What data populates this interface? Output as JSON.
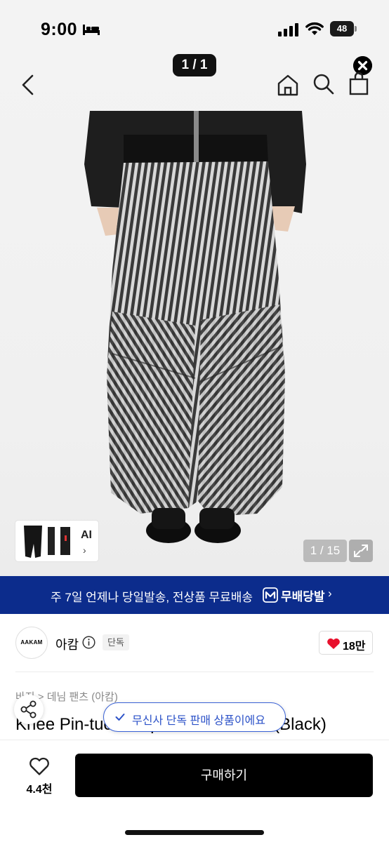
{
  "status_bar": {
    "time": "9:00",
    "battery": "48",
    "icons": [
      "bed-icon",
      "signal-icon",
      "wifi-icon",
      "battery-icon"
    ]
  },
  "top_nav": {
    "image_counter": "1 / 1",
    "icons": [
      "back-icon",
      "close-icon",
      "home-icon",
      "search-icon",
      "bag-icon"
    ]
  },
  "gallery": {
    "ai_label": "AI",
    "ai_chevron": "›",
    "page_indicator": "1 / 15",
    "expand_icon": "expand-icon"
  },
  "shipping_banner": {
    "text": "주 7일 언제나 당일발송, 전상품 무료배송",
    "brand": "무배당발",
    "chevron": "›",
    "background": "#0c2c8c"
  },
  "brand": {
    "logo_text": "AAKAM",
    "name": "아캄",
    "tag": "단독",
    "like_count": "18만",
    "heart_color": "#e8112d"
  },
  "product": {
    "breadcrumb": "바지 > 데님 팬츠 (아캄)",
    "title": "Knee Pin-tuck Striped Wide Pants (Black)",
    "exclusive_notice": "무신사 단독 판매 상품이에요"
  },
  "bottom_bar": {
    "wish_count": "4.4천",
    "buy_label": "구매하기"
  }
}
